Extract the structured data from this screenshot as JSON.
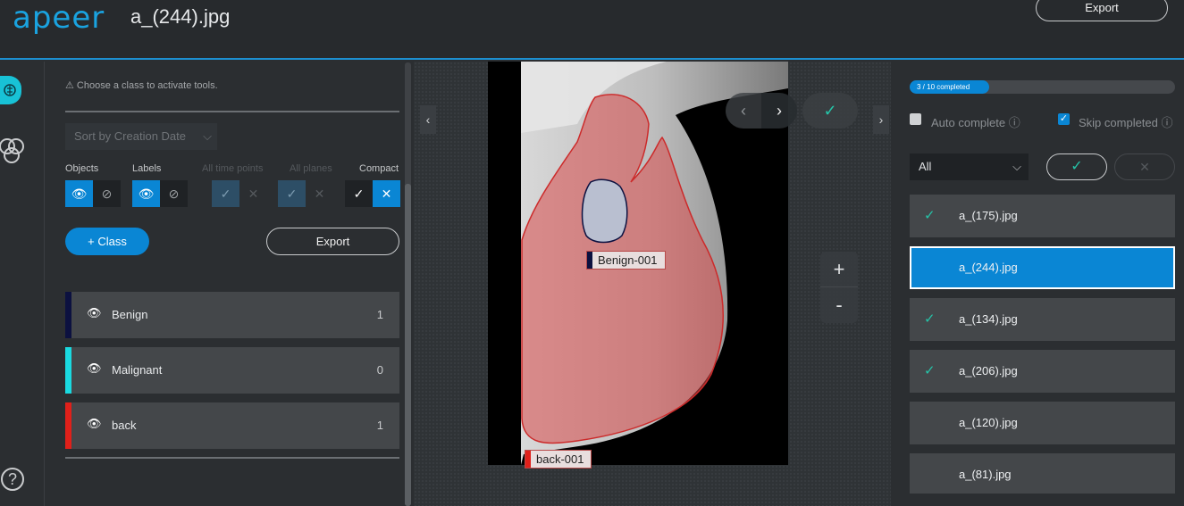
{
  "header": {
    "logo": "apeer",
    "filename": "a_(244).jpg",
    "export_label": "Export"
  },
  "left_panel": {
    "warning": "⚠ Choose a class to activate tools.",
    "sort": {
      "label": "Sort by Creation Date",
      "chevron": "⌵"
    },
    "visibility": {
      "objects": "Objects",
      "labels": "Labels",
      "all_time_points": "All time points",
      "all_planes": "All planes",
      "compact": "Compact"
    },
    "add_class_label": "+ Class",
    "export_label": "Export",
    "classes": [
      {
        "name": "Benign",
        "count": "1",
        "color": "#0c1140"
      },
      {
        "name": "Malignant",
        "count": "0",
        "color": "#1ad9e0"
      },
      {
        "name": "back",
        "count": "1",
        "color": "#e0201a"
      }
    ]
  },
  "canvas": {
    "annotations": [
      {
        "label": "Benign-001",
        "color": "#0c1140"
      },
      {
        "label": "back-001",
        "color": "#e0201a"
      }
    ],
    "zoom_in": "+",
    "zoom_out": "-"
  },
  "right_panel": {
    "progress": {
      "text": "3 / 10 completed",
      "completed": 3,
      "total": 10
    },
    "auto_complete": {
      "label": "Auto complete ⓘ",
      "checked": false
    },
    "skip_completed": {
      "label": "Skip completed ⓘ",
      "checked": true
    },
    "filter": {
      "value": "All"
    },
    "files": [
      {
        "name": "a_(175).jpg",
        "completed": true,
        "selected": false
      },
      {
        "name": "a_(244).jpg",
        "completed": false,
        "selected": true
      },
      {
        "name": "a_(134).jpg",
        "completed": true,
        "selected": false
      },
      {
        "name": "a_(206).jpg",
        "completed": true,
        "selected": false
      },
      {
        "name": "a_(120).jpg",
        "completed": false,
        "selected": false
      },
      {
        "name": "a_(81).jpg",
        "completed": false,
        "selected": false
      }
    ]
  },
  "colors": {
    "accent": "#0a86d4",
    "teal": "#25c4a8",
    "brand": "#1aa3e0"
  }
}
